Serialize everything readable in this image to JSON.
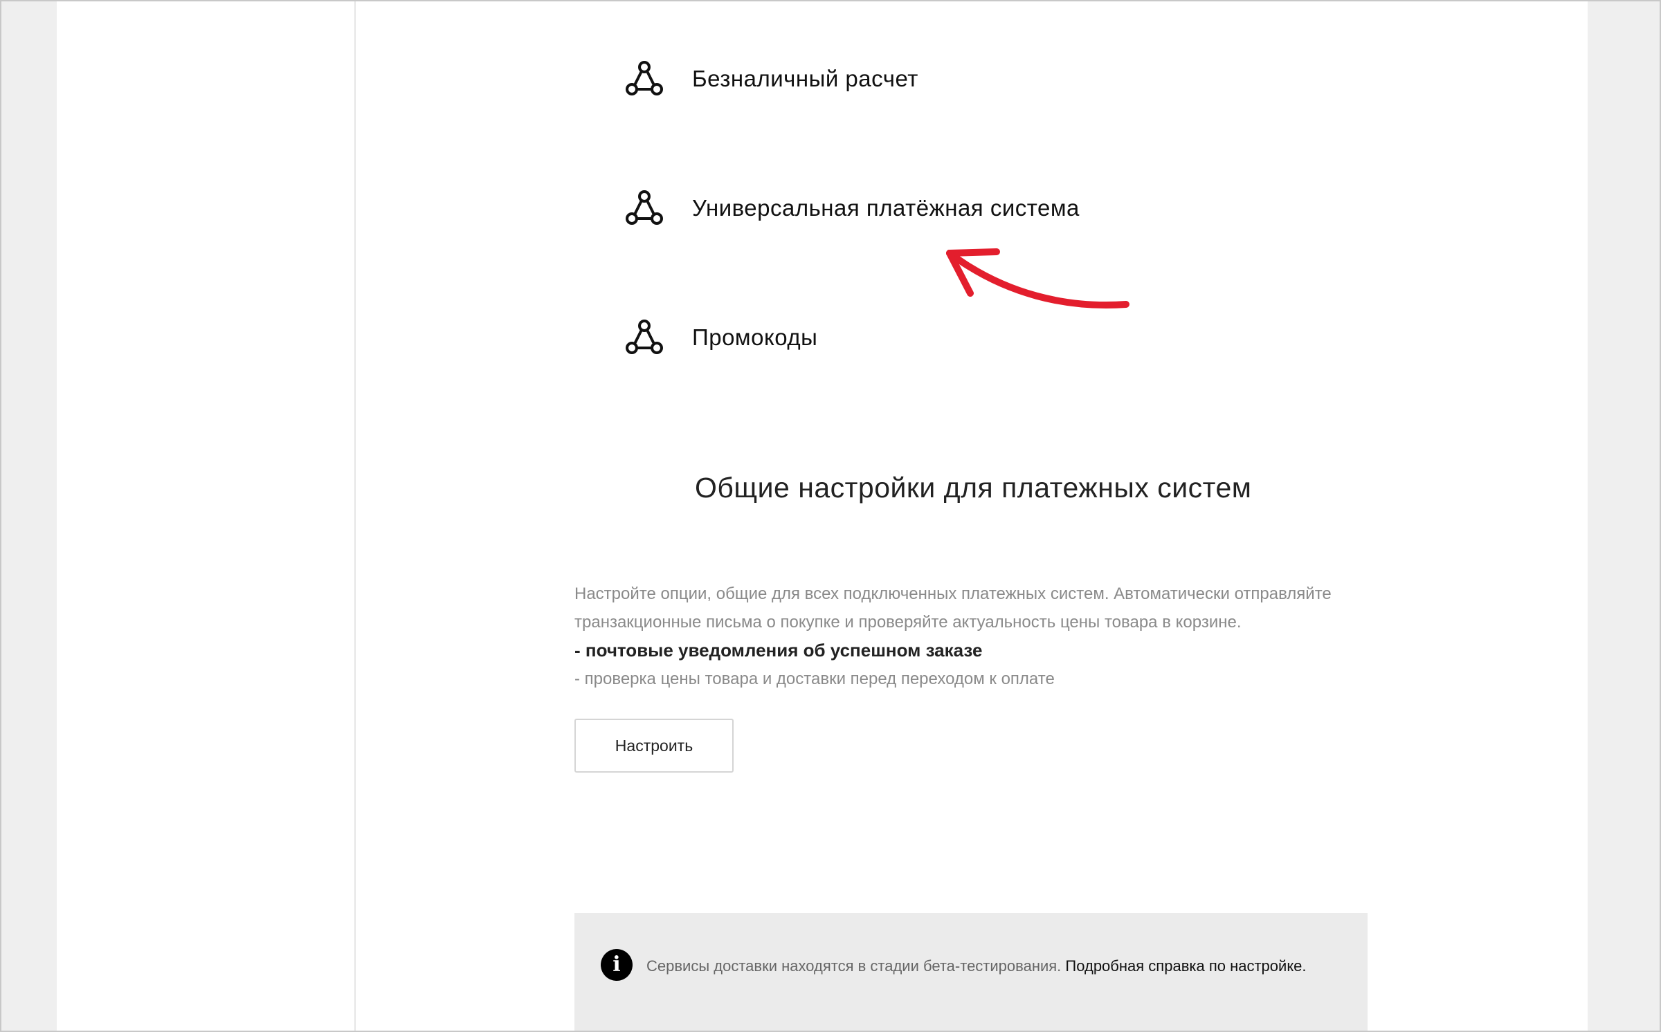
{
  "payment_systems": [
    {
      "label": "Безналичный расчет",
      "icon": "network-nodes-icon"
    },
    {
      "label": "Универсальная платёжная система",
      "icon": "network-nodes-icon"
    },
    {
      "label": "Промокоды",
      "icon": "network-nodes-icon"
    }
  ],
  "general_settings": {
    "title": "Общие настройки для платежных систем",
    "description_line_1": "Настройте опции, общие для всех подключенных платежных систем. Автоматически отправляйте",
    "description_line_2": "транзакционные письма о покупке и проверяйте актуальность цены товара в корзине.",
    "bullet_bold": "- почтовые уведомления об успешном заказе",
    "bullet_2": "- проверка цены товара и доставки перед переходом к оплате",
    "button_label": "Настроить"
  },
  "info_notice": {
    "text": "Сервисы доставки находятся в стадии бета-тестирования.",
    "link_text": "Подробная справка по настройке.",
    "icon": "info-icon"
  },
  "colors": {
    "annotation_arrow": "#e31e2d",
    "gutter": "#efefef",
    "info_box_bg": "#ebebeb"
  }
}
